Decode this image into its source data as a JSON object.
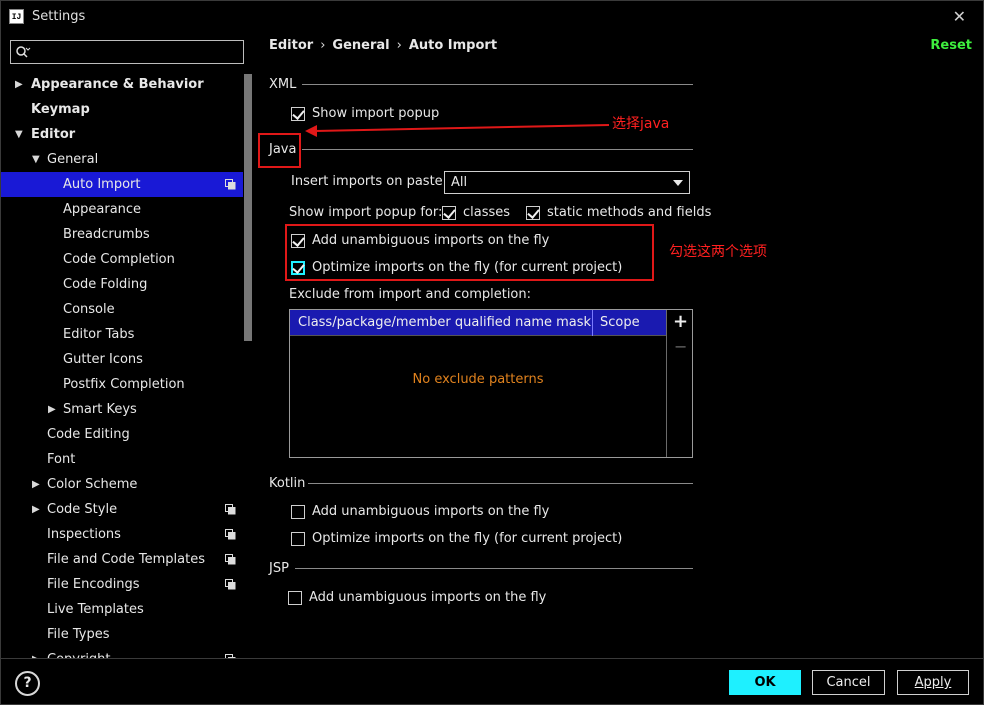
{
  "window": {
    "title": "Settings",
    "app_icon_text": "IJ"
  },
  "search": {
    "value": "",
    "placeholder": ""
  },
  "tree": [
    {
      "label": "Appearance & Behavior",
      "bold": true,
      "arrow": "right",
      "indent": 0,
      "copy": false,
      "selected": false
    },
    {
      "label": "Keymap",
      "bold": true,
      "arrow": "",
      "indent": 0,
      "copy": false,
      "selected": false
    },
    {
      "label": "Editor",
      "bold": true,
      "arrow": "down",
      "indent": 0,
      "copy": false,
      "selected": false
    },
    {
      "label": "General",
      "bold": false,
      "arrow": "down",
      "indent": 1,
      "copy": false,
      "selected": false
    },
    {
      "label": "Auto Import",
      "bold": false,
      "arrow": "",
      "indent": 2,
      "copy": true,
      "selected": true
    },
    {
      "label": "Appearance",
      "bold": false,
      "arrow": "",
      "indent": 2,
      "copy": false,
      "selected": false
    },
    {
      "label": "Breadcrumbs",
      "bold": false,
      "arrow": "",
      "indent": 2,
      "copy": false,
      "selected": false
    },
    {
      "label": "Code Completion",
      "bold": false,
      "arrow": "",
      "indent": 2,
      "copy": false,
      "selected": false
    },
    {
      "label": "Code Folding",
      "bold": false,
      "arrow": "",
      "indent": 2,
      "copy": false,
      "selected": false
    },
    {
      "label": "Console",
      "bold": false,
      "arrow": "",
      "indent": 2,
      "copy": false,
      "selected": false
    },
    {
      "label": "Editor Tabs",
      "bold": false,
      "arrow": "",
      "indent": 2,
      "copy": false,
      "selected": false
    },
    {
      "label": "Gutter Icons",
      "bold": false,
      "arrow": "",
      "indent": 2,
      "copy": false,
      "selected": false
    },
    {
      "label": "Postfix Completion",
      "bold": false,
      "arrow": "",
      "indent": 2,
      "copy": false,
      "selected": false
    },
    {
      "label": "Smart Keys",
      "bold": false,
      "arrow": "right",
      "indent": 2,
      "copy": false,
      "selected": false
    },
    {
      "label": "Code Editing",
      "bold": false,
      "arrow": "",
      "indent": 1,
      "copy": false,
      "selected": false
    },
    {
      "label": "Font",
      "bold": false,
      "arrow": "",
      "indent": 1,
      "copy": false,
      "selected": false
    },
    {
      "label": "Color Scheme",
      "bold": false,
      "arrow": "right",
      "indent": 1,
      "copy": false,
      "selected": false
    },
    {
      "label": "Code Style",
      "bold": false,
      "arrow": "right",
      "indent": 1,
      "copy": true,
      "selected": false
    },
    {
      "label": "Inspections",
      "bold": false,
      "arrow": "",
      "indent": 1,
      "copy": true,
      "selected": false
    },
    {
      "label": "File and Code Templates",
      "bold": false,
      "arrow": "",
      "indent": 1,
      "copy": true,
      "selected": false
    },
    {
      "label": "File Encodings",
      "bold": false,
      "arrow": "",
      "indent": 1,
      "copy": true,
      "selected": false
    },
    {
      "label": "Live Templates",
      "bold": false,
      "arrow": "",
      "indent": 1,
      "copy": false,
      "selected": false
    },
    {
      "label": "File Types",
      "bold": false,
      "arrow": "",
      "indent": 1,
      "copy": false,
      "selected": false
    },
    {
      "label": "Copyright",
      "bold": false,
      "arrow": "right",
      "indent": 1,
      "copy": true,
      "selected": false
    }
  ],
  "breadcrumb": {
    "part1": "Editor",
    "part2": "General",
    "part3": "Auto Import",
    "sep": "›"
  },
  "reset_label": "Reset",
  "xml": {
    "title": "XML",
    "show_import_popup": {
      "label": "Show import popup",
      "checked": true
    }
  },
  "java": {
    "title": "Java",
    "insert_on_paste_label": "Insert imports on paste:",
    "insert_on_paste_value": "All",
    "show_popup_for_label": "Show import popup for:",
    "classes": {
      "label": "classes",
      "checked": true
    },
    "static_methods": {
      "label": "static methods and fields",
      "checked": true
    },
    "add_unambiguous": {
      "label": "Add unambiguous imports on the fly",
      "checked": true
    },
    "optimize_imports": {
      "label": "Optimize imports on the fly (for current project)",
      "checked": true
    },
    "exclude_label": "Exclude from import and completion:",
    "table": {
      "columns": [
        "Class/package/member qualified name mask",
        "Scope"
      ],
      "empty_text": "No exclude patterns",
      "add_symbol": "+",
      "remove_symbol": "−"
    }
  },
  "kotlin": {
    "title": "Kotlin",
    "add_unambiguous": {
      "label": "Add unambiguous imports on the fly",
      "checked": false
    },
    "optimize_imports": {
      "label": "Optimize imports on the fly (for current project)",
      "checked": false
    }
  },
  "jsp": {
    "title": "JSP",
    "add_unambiguous": {
      "label": "Add unambiguous imports on the fly",
      "checked": false
    }
  },
  "annotations": {
    "select_java": "选择java",
    "check_both": "勾选这两个选项"
  },
  "footer": {
    "help": "?",
    "ok": "OK",
    "cancel": "Cancel",
    "apply": "Apply"
  },
  "colors": {
    "accent_ok": "#1ef0ff",
    "reset_green": "#3eef3e",
    "selection_blue": "#1919d6",
    "annotation_red": "#e01818",
    "empty_text_orange": "#e0821e"
  }
}
